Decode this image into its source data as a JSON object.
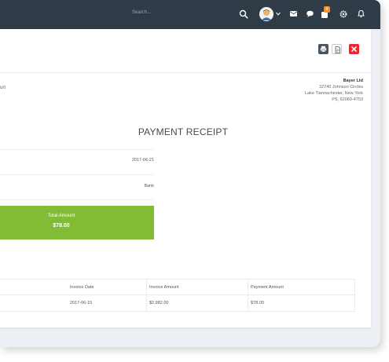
{
  "topbar": {
    "search_placeholder": "Search...",
    "badge_count": "9",
    "icons": [
      "search-icon",
      "avatar",
      "chevron-down-icon",
      "envelope-icon",
      "chat-icon",
      "tasks-icon",
      "gear-icon",
      "bell-icon"
    ]
  },
  "actions": {
    "icons": [
      "printer-icon",
      "pdf-icon",
      "close-icon"
    ]
  },
  "receipt": {
    "from_tail": "urt",
    "to": {
      "name": "Bayer Ltd",
      "address_lines": [
        "32740 Johnson Circles",
        "Lake Tiannachester, New York",
        "PS, 62060-4753"
      ]
    },
    "title": "PAYMENT RECEIPT",
    "payment_date": "2017-06-21",
    "payment_method": "Bank",
    "total_label": "Total Amount",
    "total_value": "$78.00"
  },
  "invoice_table": {
    "headers": [
      "Invoice Date",
      "Invoice Amount",
      "Payment Amount"
    ],
    "rows": [
      [
        "2017-06-15",
        "$2,982.00",
        "$78.00"
      ]
    ]
  },
  "colors": {
    "topbar_bg": "#2f3b47",
    "total_bg": "#82bc34",
    "close_button": "#e52b31",
    "badge": "#f0922a"
  }
}
